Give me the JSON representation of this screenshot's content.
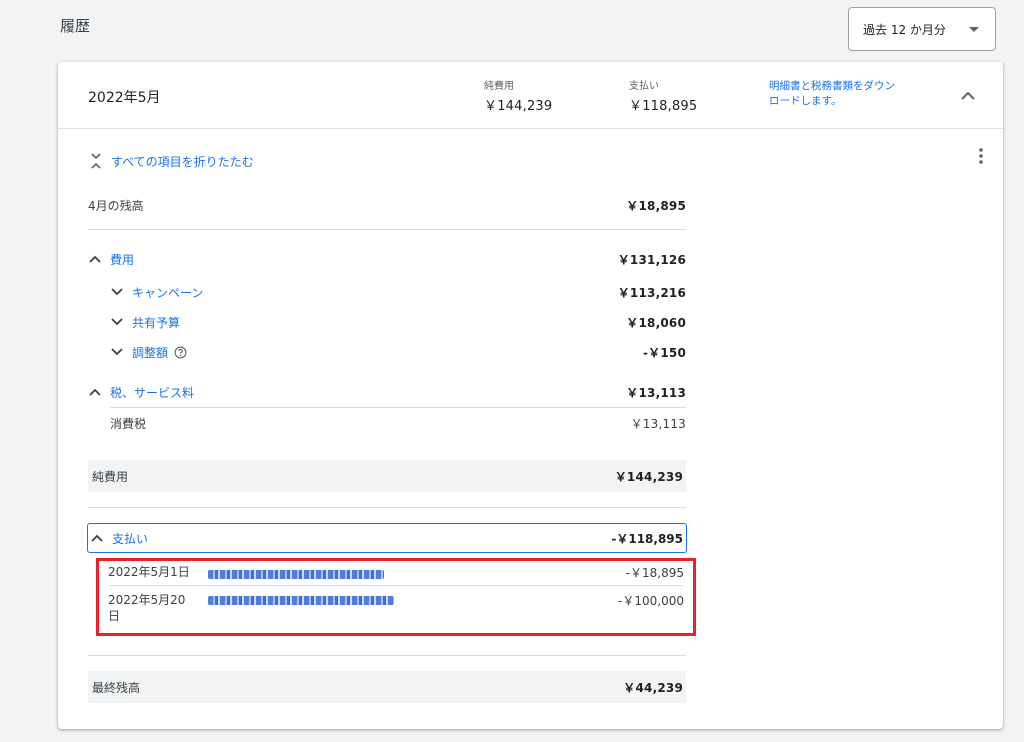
{
  "page": {
    "title": "履歴"
  },
  "range_select": {
    "value": "過去 12 か月分"
  },
  "card": {
    "month": "2022年5月",
    "net_cost": {
      "label": "純費用",
      "value": "￥144,239"
    },
    "payments": {
      "label": "支払い",
      "value": "￥118,895"
    },
    "download_link": "明細書と税務書類をダウンロードします。",
    "collapse_all": "すべての項目を折りたたむ",
    "rows": {
      "prev_balance": {
        "label": "4月の残高",
        "amount": "￥18,895"
      },
      "costs": {
        "label": "費用",
        "amount": "￥131,126"
      },
      "campaigns": {
        "label": "キャンペーン",
        "amount": "￥113,216"
      },
      "shared_budget": {
        "label": "共有予算",
        "amount": "￥18,060"
      },
      "adjustments": {
        "label": "調整額",
        "amount": "-￥150"
      },
      "tax_fees": {
        "label": "税、サービス料",
        "amount": "￥13,113"
      },
      "consumption_tax": {
        "label": "消費税",
        "amount": "￥13,113"
      },
      "net_cost": {
        "label": "純費用",
        "amount": "￥144,239"
      },
      "payments": {
        "label": "支払い",
        "amount": "-￥118,895"
      },
      "final_balance": {
        "label": "最終残高",
        "amount": "￥44,239"
      }
    },
    "payment_entries": [
      {
        "date": "2022年5月1日",
        "amount": "-￥18,895"
      },
      {
        "date": "2022年5月20日",
        "amount": "-￥100,000"
      }
    ]
  },
  "colors": {
    "link": "#1a73e8",
    "highlight": "#e8202a",
    "shade": "#f1f3f4"
  }
}
